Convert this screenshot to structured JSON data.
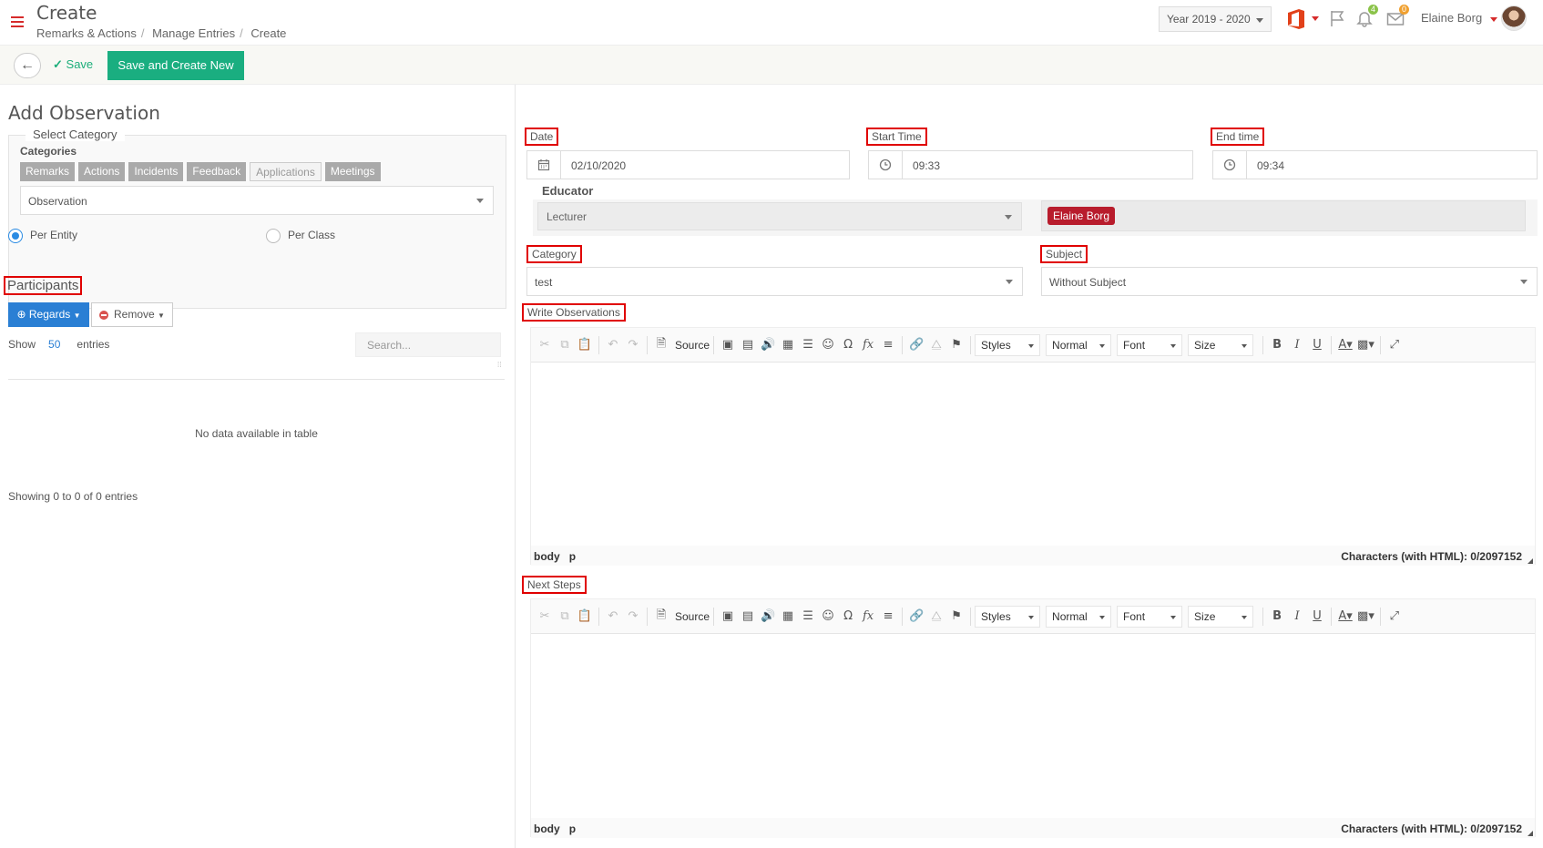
{
  "header": {
    "title": "Create",
    "breadcrumb": [
      "Remarks & Actions",
      "Manage Entries",
      "Create"
    ],
    "year": "Year 2019 - 2020",
    "notifications_count": "4",
    "messages_count": "0",
    "user_name": "Elaine Borg"
  },
  "actions": {
    "save_label": "Save",
    "save_new_label": "Save and Create New"
  },
  "left": {
    "section_title": "Add Observation",
    "category_legend": "Select Category",
    "categories_label": "Categories",
    "categories": [
      "Remarks",
      "Actions",
      "Incidents",
      "Feedback",
      "Applications",
      "Meetings"
    ],
    "selected_category": "Observation",
    "per_entity": "Per Entity",
    "per_class": "Per Class",
    "participants_label": "Participants",
    "regards_label": "Regards",
    "remove_label": "Remove",
    "show_label": "Show",
    "entries_count": "50",
    "entries_label": "entries",
    "search_placeholder": "Search...",
    "no_data": "No data available in table",
    "showing": "Showing 0 to 0 of 0 entries"
  },
  "right": {
    "date_label": "Date",
    "date_value": "02/10/2020",
    "start_label": "Start Time",
    "start_value": "09:33",
    "end_label": "End time",
    "end_value": "09:34",
    "educator_label": "Educator",
    "educator_role": "Lecturer",
    "educator_name": "Elaine Borg",
    "category_label": "Category",
    "category_value": "test",
    "subject_label": "Subject",
    "subject_value": "Without Subject",
    "write_obs_label": "Write Observations",
    "next_steps_label": "Next Steps"
  },
  "editor": {
    "source": "Source",
    "styles": "Styles",
    "format": "Normal",
    "font": "Font",
    "size": "Size",
    "path_body": "body",
    "path_p": "p",
    "char_count": "Characters (with HTML): 0/2097152"
  },
  "colors": {
    "accent_green": "#1aae80",
    "primary_blue": "#2a7fd4",
    "highlight_red": "#e00000",
    "chip_red": "#b81c2c"
  }
}
